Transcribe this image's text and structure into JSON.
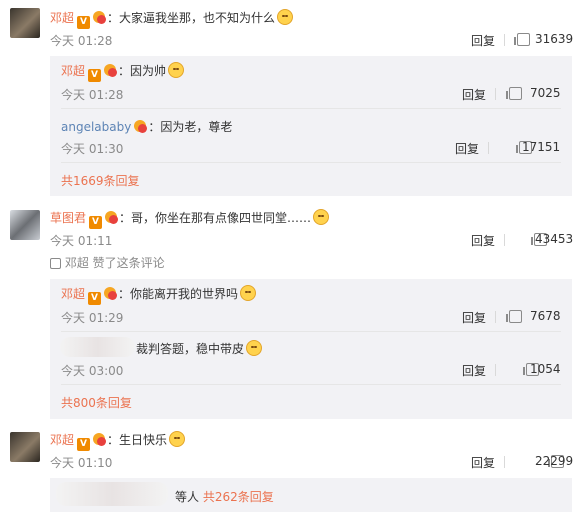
{
  "comments": [
    {
      "user": "邓超",
      "text": "：大家逼我坐那，也不知为什么",
      "time": "今天 01:28",
      "reply": "回复",
      "likes": "31639",
      "replies": [
        {
          "user": "邓超",
          "text": "：因为帅",
          "time": "今天 01:28",
          "reply": "回复",
          "likes": "7025"
        },
        {
          "user": "angelababy",
          "text": "：因为老，尊老",
          "time": "今天 01:30",
          "reply": "回复",
          "likes": "17151"
        }
      ],
      "more": "共1669条回复"
    },
    {
      "user": "草图君",
      "text": "：哥，你坐在那有点像四世同堂……",
      "time": "今天 01:11",
      "reply": "回复",
      "likes": "43453",
      "liked_by": "邓超 赞了这条评论",
      "replies": [
        {
          "user": "邓超",
          "text": "：你能离开我的世界吗",
          "time": "今天 01:29",
          "reply": "回复",
          "likes": "7678"
        },
        {
          "user": "",
          "text": "裁判答题，稳中带皮",
          "time": "今天 03:00",
          "reply": "回复",
          "likes": "1054"
        }
      ],
      "more": "共800条回复"
    },
    {
      "user": "邓超",
      "text": "：生日快乐",
      "time": "今天 01:10",
      "reply": "回复",
      "likes": "22299",
      "tail_text": "等人",
      "tail_more": "共262条回复"
    }
  ],
  "badges": {
    "verified": "V"
  },
  "colors": {
    "username": "#eb7350",
    "username_blue": "#5d84b5",
    "link": "#eb7350",
    "subbox": "#f2f2f5"
  }
}
